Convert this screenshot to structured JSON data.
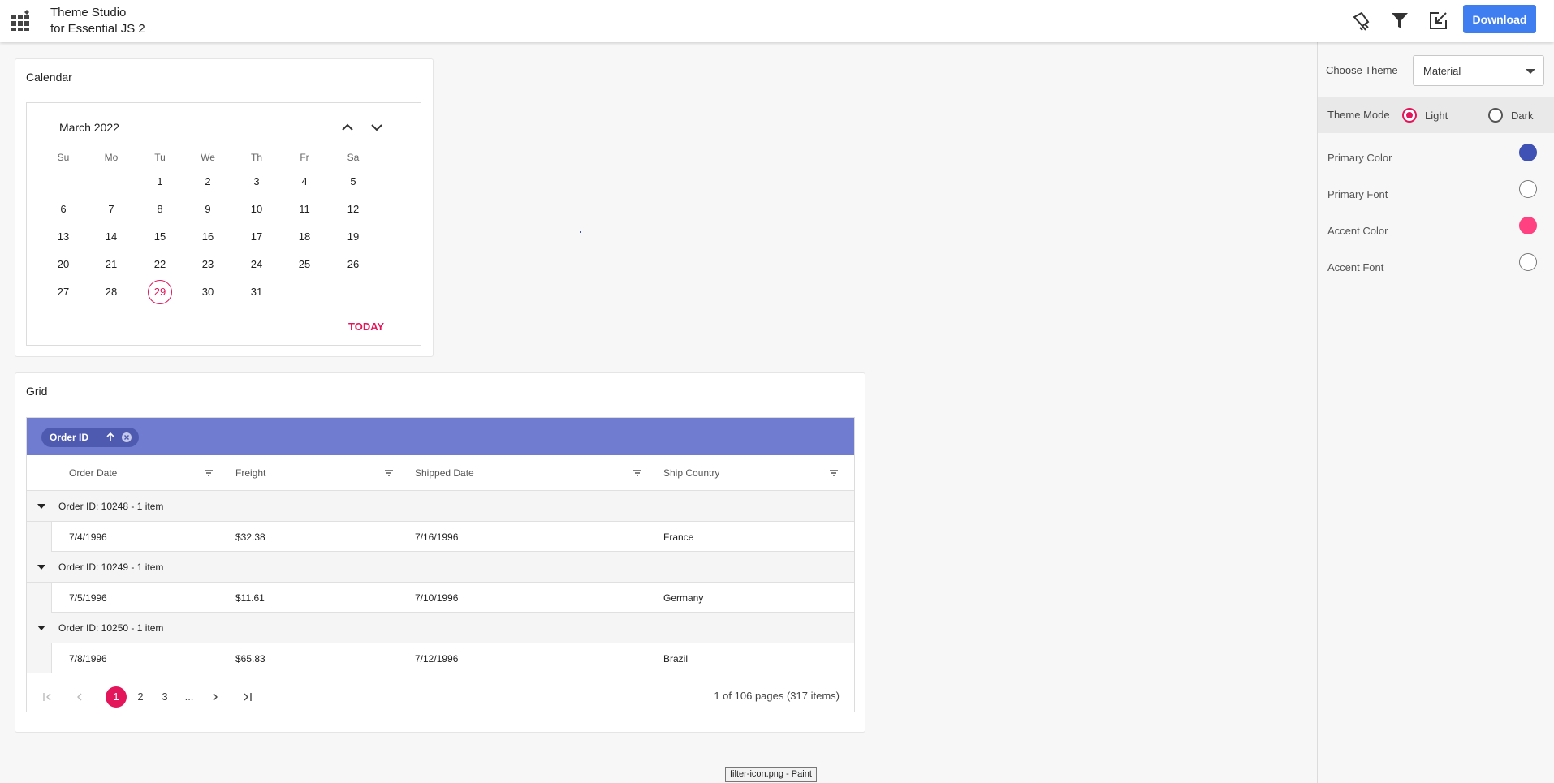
{
  "header": {
    "title_line1": "Theme Studio",
    "title_line2": "for Essential JS 2",
    "download_label": "Download",
    "icons": [
      "apps-grid-icon",
      "brush-icon",
      "filter-icon",
      "export-icon"
    ]
  },
  "calendar_card": {
    "title": "Calendar",
    "month_label": "March 2022",
    "days_of_week": [
      "Su",
      "Mo",
      "Tu",
      "We",
      "Th",
      "Fr",
      "Sa"
    ],
    "weeks": [
      [
        "",
        "",
        "1",
        "2",
        "3",
        "4",
        "5"
      ],
      [
        "6",
        "7",
        "8",
        "9",
        "10",
        "11",
        "12"
      ],
      [
        "13",
        "14",
        "15",
        "16",
        "17",
        "18",
        "19"
      ],
      [
        "20",
        "21",
        "22",
        "23",
        "24",
        "25",
        "26"
      ],
      [
        "27",
        "28",
        "29",
        "30",
        "31",
        "",
        ""
      ]
    ],
    "selected_day": "29",
    "today_label": "TODAY"
  },
  "grid_card": {
    "title": "Grid",
    "group_chip": "Order ID",
    "columns": [
      "Order Date",
      "Freight",
      "Shipped Date",
      "Ship Country"
    ],
    "groups": [
      {
        "caption": "Order ID: 10248 - 1 item",
        "row": [
          "7/4/1996",
          "$32.38",
          "7/16/1996",
          "France"
        ]
      },
      {
        "caption": "Order ID: 10249 - 1 item",
        "row": [
          "7/5/1996",
          "$11.61",
          "7/10/1996",
          "Germany"
        ]
      },
      {
        "caption": "Order ID: 10250 - 1 item",
        "row": [
          "7/8/1996",
          "$65.83",
          "7/12/1996",
          "Brazil"
        ]
      }
    ],
    "pager": {
      "pages": [
        "1",
        "2",
        "3",
        "..."
      ],
      "active": "1",
      "info": "1 of 106 pages (317 items)"
    }
  },
  "right_panel": {
    "choose_theme_label": "Choose Theme",
    "theme_value": "Material",
    "theme_mode_label": "Theme Mode",
    "mode_light": "Light",
    "mode_dark": "Dark",
    "selected_mode": "Light",
    "properties": [
      {
        "label": "Primary Color",
        "color": "#3f51b5"
      },
      {
        "label": "Primary Font",
        "color": "#ffffff"
      },
      {
        "label": "Accent Color",
        "color": "#ff4081"
      },
      {
        "label": "Accent Font",
        "color": "#ffffff"
      }
    ]
  },
  "taskbar_tooltip": "filter-icon.png - Paint",
  "colors": {
    "accent": "#e3165b",
    "primary": "#3f7ef1",
    "group_bar": "#6f7cd0"
  }
}
